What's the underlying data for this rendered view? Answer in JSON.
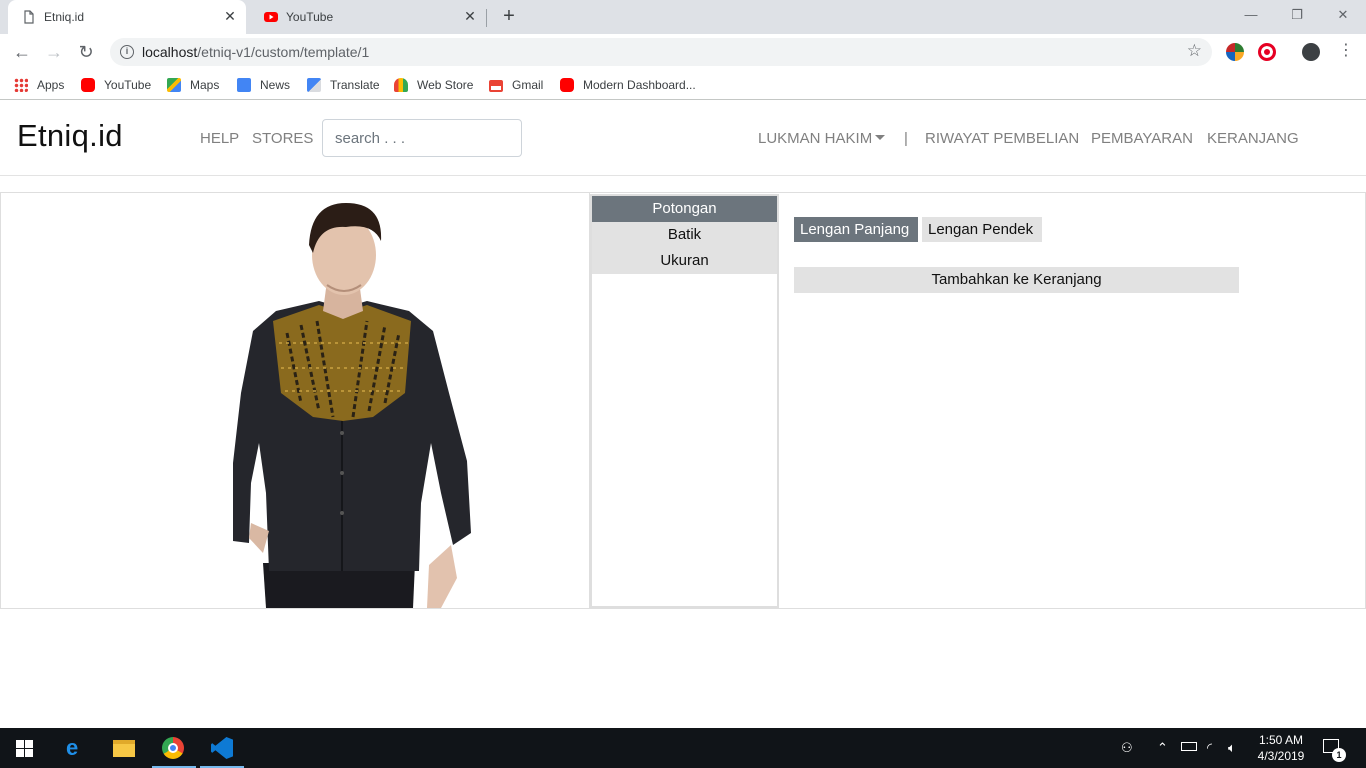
{
  "browser": {
    "tabs": [
      {
        "title": "Etniq.id",
        "active": true
      },
      {
        "title": "YouTube",
        "active": false
      }
    ],
    "url_host": "localhost",
    "url_path": "/etniq-v1/custom/template/1",
    "bookmarks": [
      "Apps",
      "YouTube",
      "Maps",
      "News",
      "Translate",
      "Web Store",
      "Gmail",
      "Modern Dashboard..."
    ]
  },
  "header": {
    "brand": "Etniq.id",
    "nav_left": [
      "HELP",
      "STORES"
    ],
    "search_placeholder": "search . . .",
    "user": "LUKMAN HAKIM",
    "separator": "|",
    "nav_right": [
      "RIWAYAT PEMBELIAN",
      "PEMBAYARAN",
      "KERANJANG"
    ]
  },
  "customizer": {
    "menu": [
      {
        "label": "Potongan",
        "active": true
      },
      {
        "label": "Batik",
        "active": false
      },
      {
        "label": "Ukuran",
        "active": false
      }
    ],
    "options": [
      {
        "label": "Lengan Panjang",
        "active": true
      },
      {
        "label": "Lengan Pendek",
        "active": false
      }
    ],
    "add_to_cart": "Tambahkan ke Keranjang"
  },
  "taskbar": {
    "time": "1:50 AM",
    "date": "4/3/2019",
    "notification_count": "1"
  },
  "colors": {
    "active_button": "#6c757d",
    "inactive_button": "#e2e2e2",
    "nav_text": "#808080",
    "taskbar": "#101418"
  }
}
